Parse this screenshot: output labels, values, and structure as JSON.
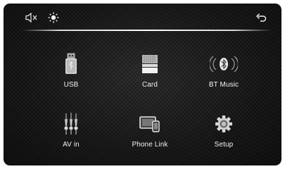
{
  "topbar": {
    "icons": [
      "speaker-mute-icon",
      "brightness-icon",
      "back-arrow-icon"
    ]
  },
  "menu": {
    "items": [
      {
        "label": "USB",
        "icon": "usb-drive-icon"
      },
      {
        "label": "Card",
        "icon": "sd-card-icon"
      },
      {
        "label": "BT Music",
        "icon": "bluetooth-icon"
      },
      {
        "label": "AV in",
        "icon": "rca-cable-icon"
      },
      {
        "label": "Phone Link",
        "icon": "phone-link-icon"
      },
      {
        "label": "Setup",
        "icon": "gear-icon"
      }
    ]
  },
  "colors": {
    "background": "#1a1a1a",
    "text": "#f2f2f2",
    "accent": "#e0e0e0"
  }
}
